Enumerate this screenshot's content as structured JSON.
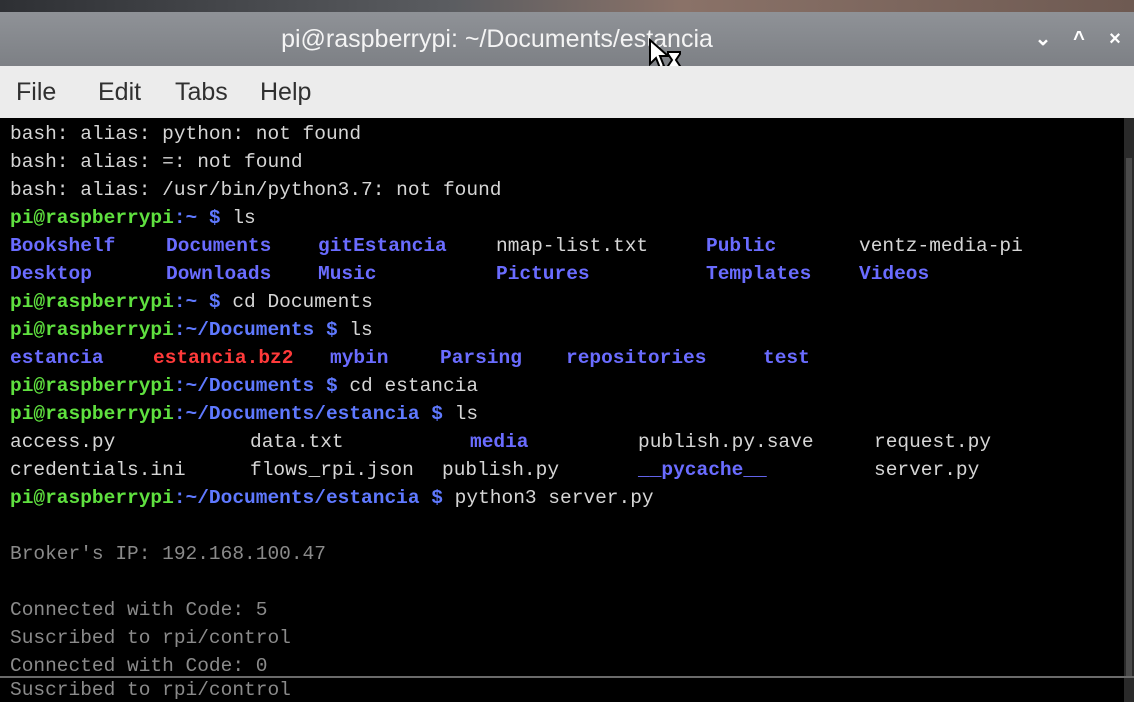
{
  "window": {
    "title": "pi@raspberrypi: ~/Documents/estancia",
    "minimize_glyph": "⌄",
    "maximize_glyph": "^",
    "close_glyph": "×"
  },
  "menu": {
    "file": "File",
    "edit": "Edit",
    "tabs": "Tabs",
    "help": "Help"
  },
  "terminal": {
    "prompt_user": "pi@raspberrypi",
    "lines": {
      "l1": "bash: alias: python: not found",
      "l2": "bash: alias: =: not found",
      "l3": "bash: alias: /usr/bin/python3.7: not found",
      "p4_path": ":~ $",
      "p4_cmd": " ls",
      "p7_path": ":~ $",
      "p7_cmd": " cd Documents",
      "p8_path": ":~/Documents $",
      "p8_cmd": " ls",
      "p10_path": ":~/Documents $",
      "p10_cmd": " cd estancia",
      "p11_path": ":~/Documents/estancia $",
      "p11_cmd": " ls",
      "p14_path": ":~/Documents/estancia $",
      "p14_cmd": " python3 server.py",
      "broker": "Broker's IP: 192.168.100.47",
      "conn1": "Connected with Code: 5",
      "sub1": "Suscribed to rpi/control",
      "conn2": "Connected with Code: 0",
      "sub2": "Suscribed to rpi/control"
    },
    "home_listing": {
      "row1": [
        "Bookshelf",
        "Documents",
        "gitEstancia",
        "nmap-list.txt",
        "Public",
        "ventz-media-pi"
      ],
      "row2": [
        "Desktop",
        "Downloads",
        "Music",
        "Pictures",
        "Templates",
        "Videos"
      ]
    },
    "documents_listing": [
      "estancia",
      "estancia.bz2",
      "mybin",
      "Parsing",
      "repositories",
      "test"
    ],
    "estancia_listing": {
      "row1": [
        "access.py",
        "data.txt",
        "media",
        "publish.py.save",
        "request.py"
      ],
      "row2": [
        "credentials.ini",
        "flows_rpi.json",
        "publish.py",
        "__pycache__",
        "server.py"
      ]
    }
  },
  "colors": {
    "prompt_user": "#5fe03f",
    "prompt_path": "#5f79ff",
    "directory": "#6a6cff",
    "archive": "#ff3a3a",
    "terminal_bg": "#000000",
    "titlebar": "#858890"
  }
}
